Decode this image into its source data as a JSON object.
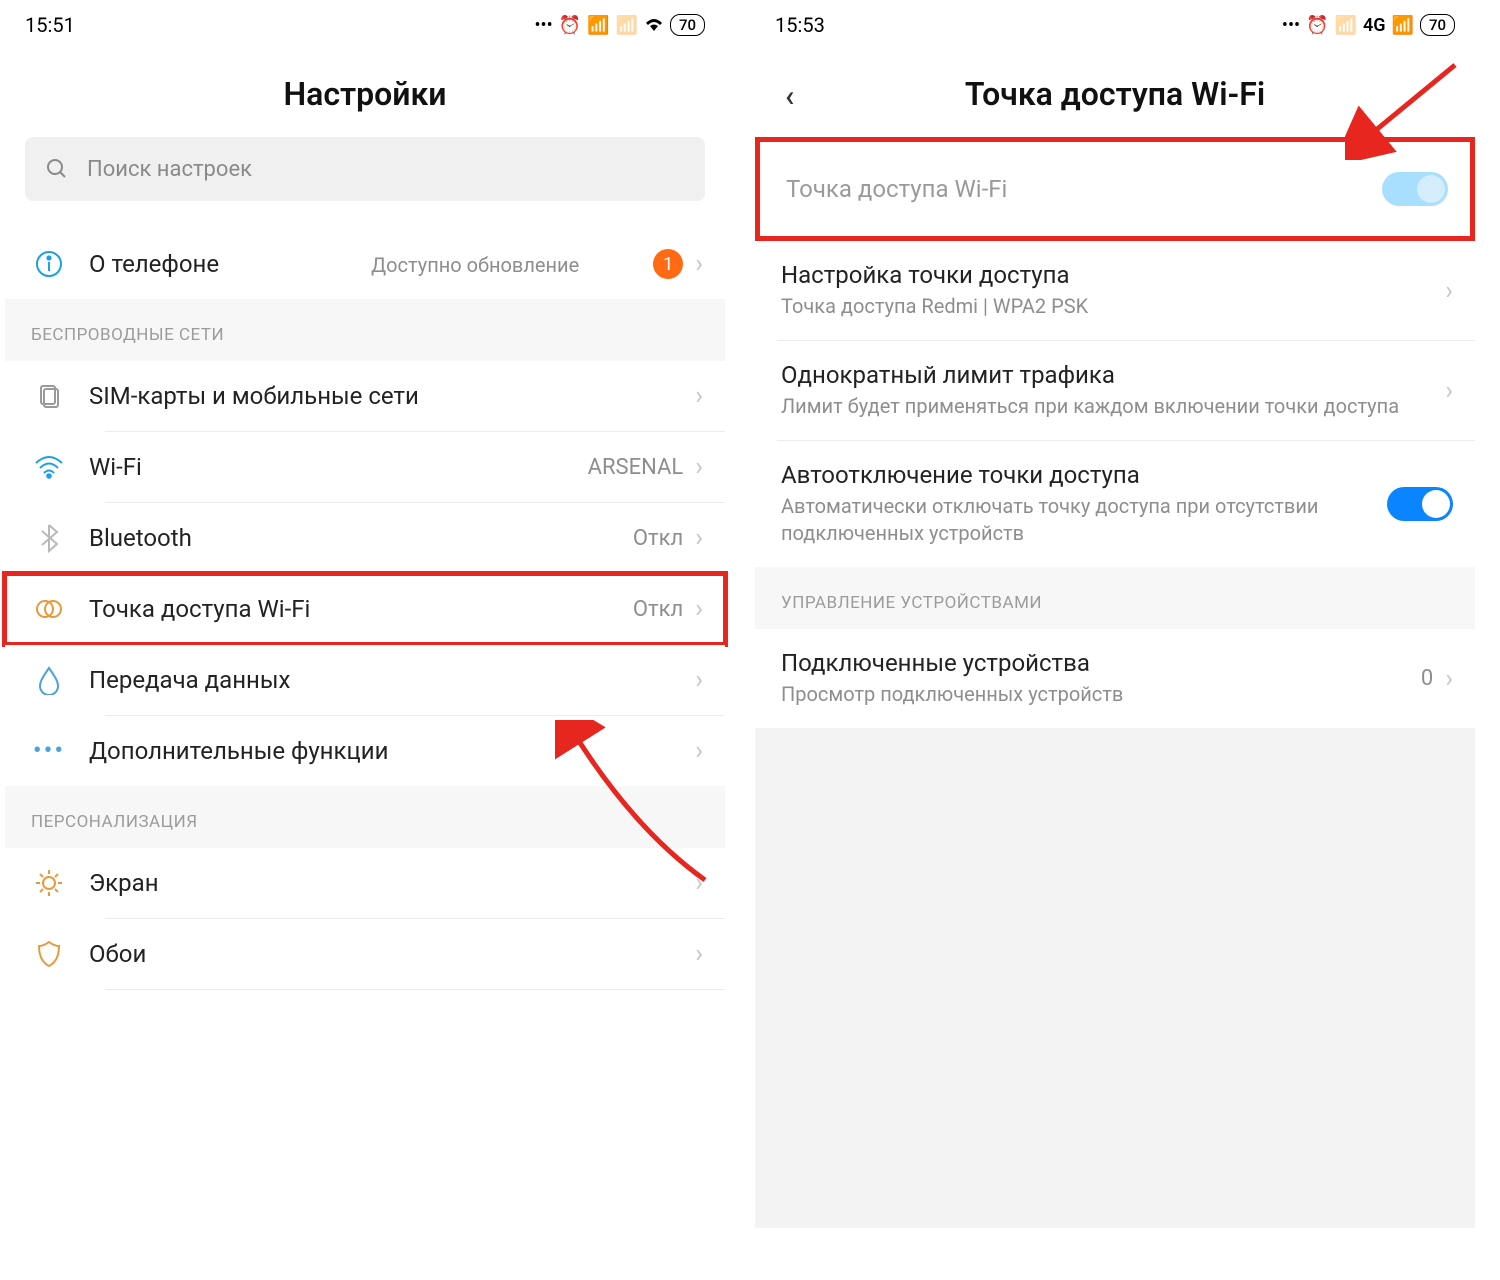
{
  "left": {
    "status": {
      "time": "15:51",
      "battery": "70"
    },
    "header": "Настройки",
    "search_placeholder": "Поиск настроек",
    "about": {
      "title": "О телефоне",
      "sub": "Доступно обновление",
      "badge": "1"
    },
    "section_wireless": "БЕСПРОВОДНЫЕ СЕТИ",
    "rows": {
      "sim": "SIM-карты и мобильные сети",
      "wifi": "Wi-Fi",
      "wifi_value": "ARSENAL",
      "bt": "Bluetooth",
      "bt_value": "Откл",
      "hotspot": "Точка доступа Wi-Fi",
      "hotspot_value": "Откл",
      "data": "Передача данных",
      "more": "Дополнительные функции"
    },
    "section_personal": "ПЕРСОНАЛИЗАЦИЯ",
    "rows2": {
      "display": "Экран",
      "wallpaper": "Обои"
    }
  },
  "right": {
    "status": {
      "time": "15:53",
      "net": "4G",
      "battery": "70"
    },
    "header": "Точка доступа Wi-Fi",
    "toggle_row": "Точка доступа Wi-Fi",
    "setup": {
      "title": "Настройка точки доступа",
      "sub": "Точка доступа Redmi | WPA2 PSK"
    },
    "limit": {
      "title": "Однократный лимит трафика",
      "sub": "Лимит будет применяться при каждом включении точки доступа"
    },
    "auto_off": {
      "title": "Автоотключение точки доступа",
      "sub": "Автоматически отключать точку доступа при отсутствии подключенных устройств"
    },
    "section_devices": "УПРАВЛЕНИЕ УСТРОЙСТВАМИ",
    "devices": {
      "title": "Подключенные устройства",
      "sub": "Просмотр подключенных устройств",
      "value": "0"
    }
  }
}
